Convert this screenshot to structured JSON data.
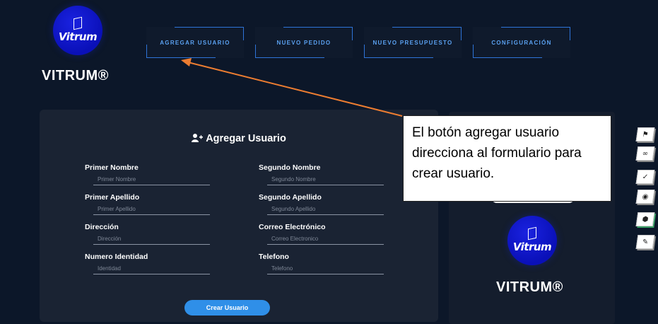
{
  "brand": {
    "logo_word": "Vitrum",
    "title": "VITRUM®"
  },
  "nav": [
    {
      "label": "AGREGAR USUARIO"
    },
    {
      "label": "NUEVO PEDIDO"
    },
    {
      "label": "NUEVO PRESUPUESTO"
    },
    {
      "label": "CONFIGURACIÓN"
    }
  ],
  "form": {
    "title": "Agregar Usuario",
    "fields": [
      {
        "label": "Primer Nombre",
        "placeholder": "Primer Nombre"
      },
      {
        "label": "Segundo Nombre",
        "placeholder": "Segundo Nombre"
      },
      {
        "label": "Primer Apellido",
        "placeholder": "Primer Apellido"
      },
      {
        "label": "Segundo Apellido",
        "placeholder": "Segundo Apellido"
      },
      {
        "label": "Dirección",
        "placeholder": "Dirección"
      },
      {
        "label": "Correo Electrónico",
        "placeholder": "Correo Electronico"
      },
      {
        "label": "Numero Identidad",
        "placeholder": "Identidad"
      },
      {
        "label": "Telefono",
        "placeholder": "Telefono"
      }
    ],
    "submit_label": "Crear Usuario"
  },
  "side_panel": {
    "logo_word": "Vitrum",
    "title": "VITRUM®"
  },
  "side_icons": [
    "flag-icon",
    "link-icon",
    "check-icon",
    "eye-icon",
    "shield-icon",
    "signature-icon"
  ],
  "callout": {
    "text": "El botón agregar usuario direcciona al formulario para crear usuario."
  },
  "colors": {
    "background": "#0c1729",
    "accent": "#2f8fe8",
    "nav_text": "#5aa0ef",
    "logo_blue": "#0a10b8",
    "arrow": "#ed7d31"
  }
}
